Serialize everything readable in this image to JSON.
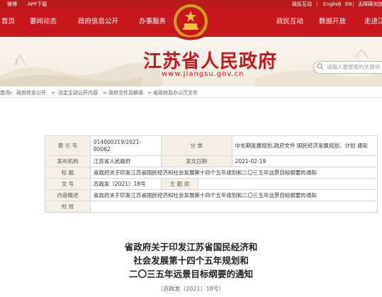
{
  "topbar": {
    "weibo": "微博",
    "app": "APP下载",
    "gov_service": "政民互动",
    "english": "English",
    "en": "EN",
    "accessible": "无障碍浏览"
  },
  "nav": {
    "home": "首页",
    "news": "要闻动态",
    "open": "政府信息公开",
    "service": "办事服务",
    "interact": "政民互动",
    "data": "数据开放",
    "jiangsu": "走进江"
  },
  "banner": {
    "title": "江苏省人民政府",
    "domain": "www.jiangsu.gov.cn",
    "search_placeholder": "请输入要搜索的关键词"
  },
  "breadcrumb": {
    "items": [
      "首页",
      "政府信息公开",
      "法定主动公开内容",
      "政府文件及解读",
      "省政府及办公厅文件"
    ],
    "separator": ">"
  },
  "info": {
    "index_label": "索 引 号",
    "index_value": "014000319/2021-00062",
    "category_label": "分 类",
    "category_value": "中长期发展规划,政府文件 国民经济发展规划、计划 通知",
    "issuer_label": "发布机构",
    "issuer_value": "江苏省人民政府",
    "date_label": "发文日期",
    "date_value": "2021-02-19",
    "title_label": "标 题",
    "title_value": "省政府关于印发江苏省国民经济和社会发展第十四个五年规划和二〇三五年远景目标纲要的通知",
    "docno_label": "文 号",
    "docno_value": "苏政发〔2021〕18号",
    "subject_label": "主 题 词",
    "subject_value": "",
    "summary_label": "内容概述",
    "summary_value": "省政府关于印发江苏省国民经济和社会发展第十四个五年规划和二〇三五年远景目标纲要的通知",
    "validity_label": "时 效",
    "validity_value": ""
  },
  "doc": {
    "title_line1": "省政府关于印发江苏省国民经济和",
    "title_line2": "社会发展第十四个五年规划和",
    "title_line3": "二〇三五年远景目标纲要的通知",
    "doc_no": "（苏政发〔2021〕18号）"
  },
  "colors": {
    "brand_red": "#c8161d",
    "banner_bg": "#f3ebe0",
    "table_label_bg": "#f5efe7"
  }
}
